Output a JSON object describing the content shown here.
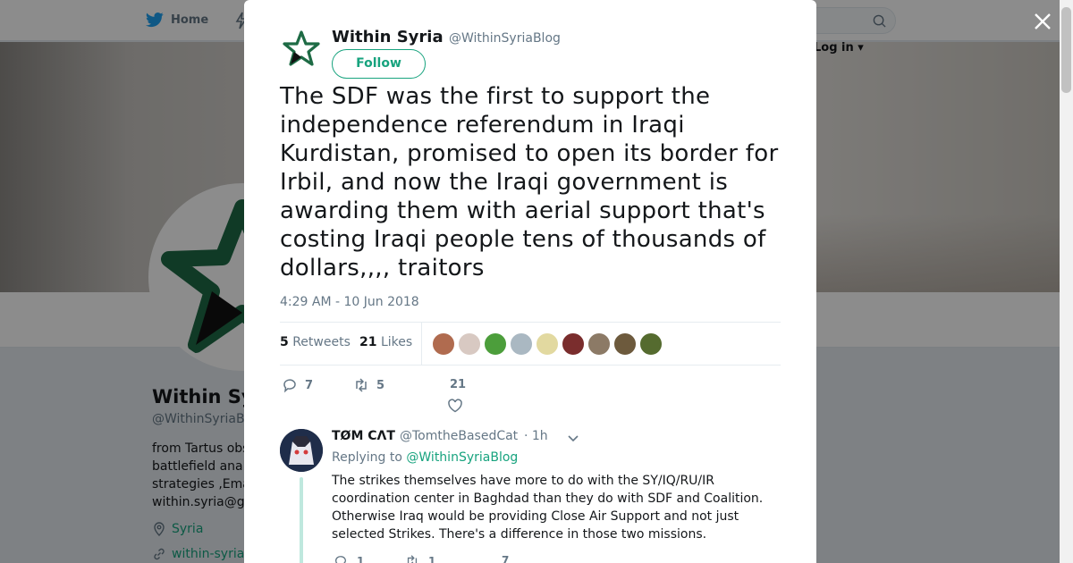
{
  "background": {
    "nav_home_label": "Home",
    "login_label": "Log in",
    "profile_name": "Within Syria",
    "profile_handle": "@WithinSyriaBlog",
    "bio_lines": [
      "from Tartus observing",
      "battlefield analysis",
      "strategies ,Email",
      "within.syria@gmail.com"
    ],
    "location": "Syria",
    "url": "within-syria"
  },
  "tweet": {
    "author_name": "Within Syria",
    "author_handle": "@WithinSyriaBlog",
    "follow_label": "Follow",
    "text": "The SDF was the first to support the independence referendum in Iraqi Kurdistan, promised to open its border for Irbil, and now the Iraqi government is awarding them with aerial support that's costing Iraqi people tens of thousands of dollars,,,, traitors",
    "timestamp": "4:29 AM - 10 Jun 2018",
    "retweets_count": "5",
    "retweets_label": "Retweets",
    "likes_count": "21",
    "likes_label": "Likes",
    "reply_count": "7",
    "retweet_count_action": "5",
    "like_count_action": "21"
  },
  "likers": [
    {
      "name": "liker-1",
      "color": "#b06b4f"
    },
    {
      "name": "liker-2",
      "color": "#d8c9c2"
    },
    {
      "name": "liker-3",
      "color": "#4c9e3b"
    },
    {
      "name": "liker-4",
      "color": "#aab8c2"
    },
    {
      "name": "liker-5",
      "color": "#e2d9a0"
    },
    {
      "name": "liker-6",
      "color": "#7a2d2d"
    },
    {
      "name": "liker-7",
      "color": "#8c7a66"
    },
    {
      "name": "liker-8",
      "color": "#6d5a3d"
    },
    {
      "name": "liker-9",
      "color": "#556b2f"
    }
  ],
  "reply": {
    "author_name": "TØM CΛT",
    "author_handle": "@TomtheBasedCat",
    "time": "· 1h",
    "replying_prefix": "Replying to",
    "replying_to": "@WithinSyriaBlog",
    "text": "The strikes themselves have more to do with the SY/IQ/RU/IR coordination center in Baghdad than they do with SDF and Coalition. Otherwise Iraq would be providing Close Air Support and not just selected Strikes. There's a difference in those two missions.",
    "reply_count": "1",
    "retweet_count": "1",
    "like_count": "7"
  },
  "colors": {
    "accent": "#17a37e",
    "twitter_blue": "#1da1f2",
    "muted": "#657786"
  }
}
